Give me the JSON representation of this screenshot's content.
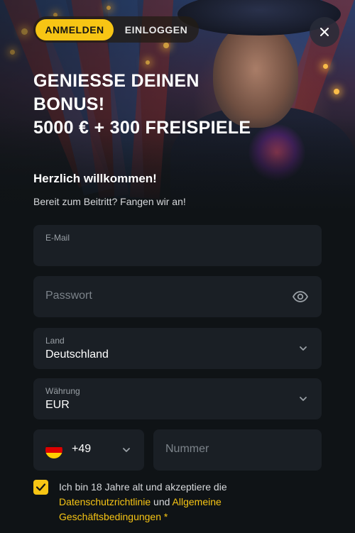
{
  "tabs": {
    "register_label": "ANMELDEN",
    "login_label": "EINLOGGEN"
  },
  "headline": {
    "line1": "GENIESSE DEINEN",
    "line2": "BONUS!",
    "line3": "5000 € + 300 FREISPIELE"
  },
  "welcome": {
    "title": "Herzlich willkommen!",
    "subtitle": "Bereit zum Beitritt? Fangen wir an!"
  },
  "form": {
    "email": {
      "label": "E-Mail",
      "value": ""
    },
    "password": {
      "placeholder": "Passwort"
    },
    "country": {
      "label": "Land",
      "value": "Deutschland"
    },
    "currency": {
      "label": "Währung",
      "value": "EUR"
    },
    "phone": {
      "code": "+49",
      "placeholder": "Nummer"
    }
  },
  "consent": {
    "text_before": "Ich bin 18 Jahre alt und akzeptiere die",
    "privacy_link": "Datenschutzrichtlinie",
    "text_and": " und ",
    "terms_link_part1": "Allgemeine",
    "terms_link_part2": "Geschäftsbedingungen",
    "required_mark": " *",
    "checked": true
  },
  "colors": {
    "accent": "#f7c514",
    "background": "#0f1316",
    "field": "#1a1f25",
    "muted_text": "#9aa0a6"
  },
  "icons": [
    "close-icon",
    "eye-icon",
    "chevron-down-icon",
    "germany-flag-icon",
    "checkmark-icon"
  ]
}
